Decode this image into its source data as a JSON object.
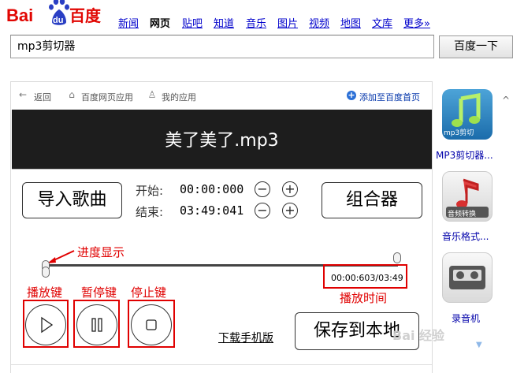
{
  "header": {
    "logo_parts": [
      "Bai",
      "du",
      "百度"
    ],
    "nav": [
      "新闻",
      "网页",
      "贴吧",
      "知道",
      "音乐",
      "图片",
      "视频",
      "地图",
      "文库",
      "更多»"
    ],
    "nav_active_index": 1
  },
  "search": {
    "value": "mp3剪切器",
    "button_label": "百度一下"
  },
  "app_toolbar": {
    "back": "返回",
    "home": "百度网页应用",
    "mine": "我的应用",
    "add_home": "添加至百度首页"
  },
  "player": {
    "song_title": "美了美了.mp3",
    "import_label": "导入歌曲",
    "mixer_label": "组合器",
    "start_label": "开始:",
    "start_time": "00:00:000",
    "end_label": "结束:",
    "end_time": "03:49:041",
    "minus_glyph": "−",
    "plus_glyph": "+",
    "time_readout": "00:00:603/03:49",
    "progress_fraction": 0.0,
    "download_link": "下载手机版",
    "save_label": "保存到本地"
  },
  "annotations": {
    "progress": "进度显示",
    "play": "播放键",
    "pause": "暂停键",
    "stop": "停止键",
    "play_time": "播放时间",
    "accent_color": "#e00000"
  },
  "right_rail": {
    "apps": [
      {
        "caption": "MP3剪切器...",
        "icon": "music-note-icon",
        "tile_text": "mp3剪切"
      },
      {
        "caption": "音乐格式...",
        "icon": "music-note-icon",
        "tile_text": "音频转换"
      },
      {
        "caption": "录音机",
        "icon": "cassette-icon",
        "tile_text": ""
      }
    ],
    "scroll_up": "^"
  },
  "watermark": "Bai 经验"
}
